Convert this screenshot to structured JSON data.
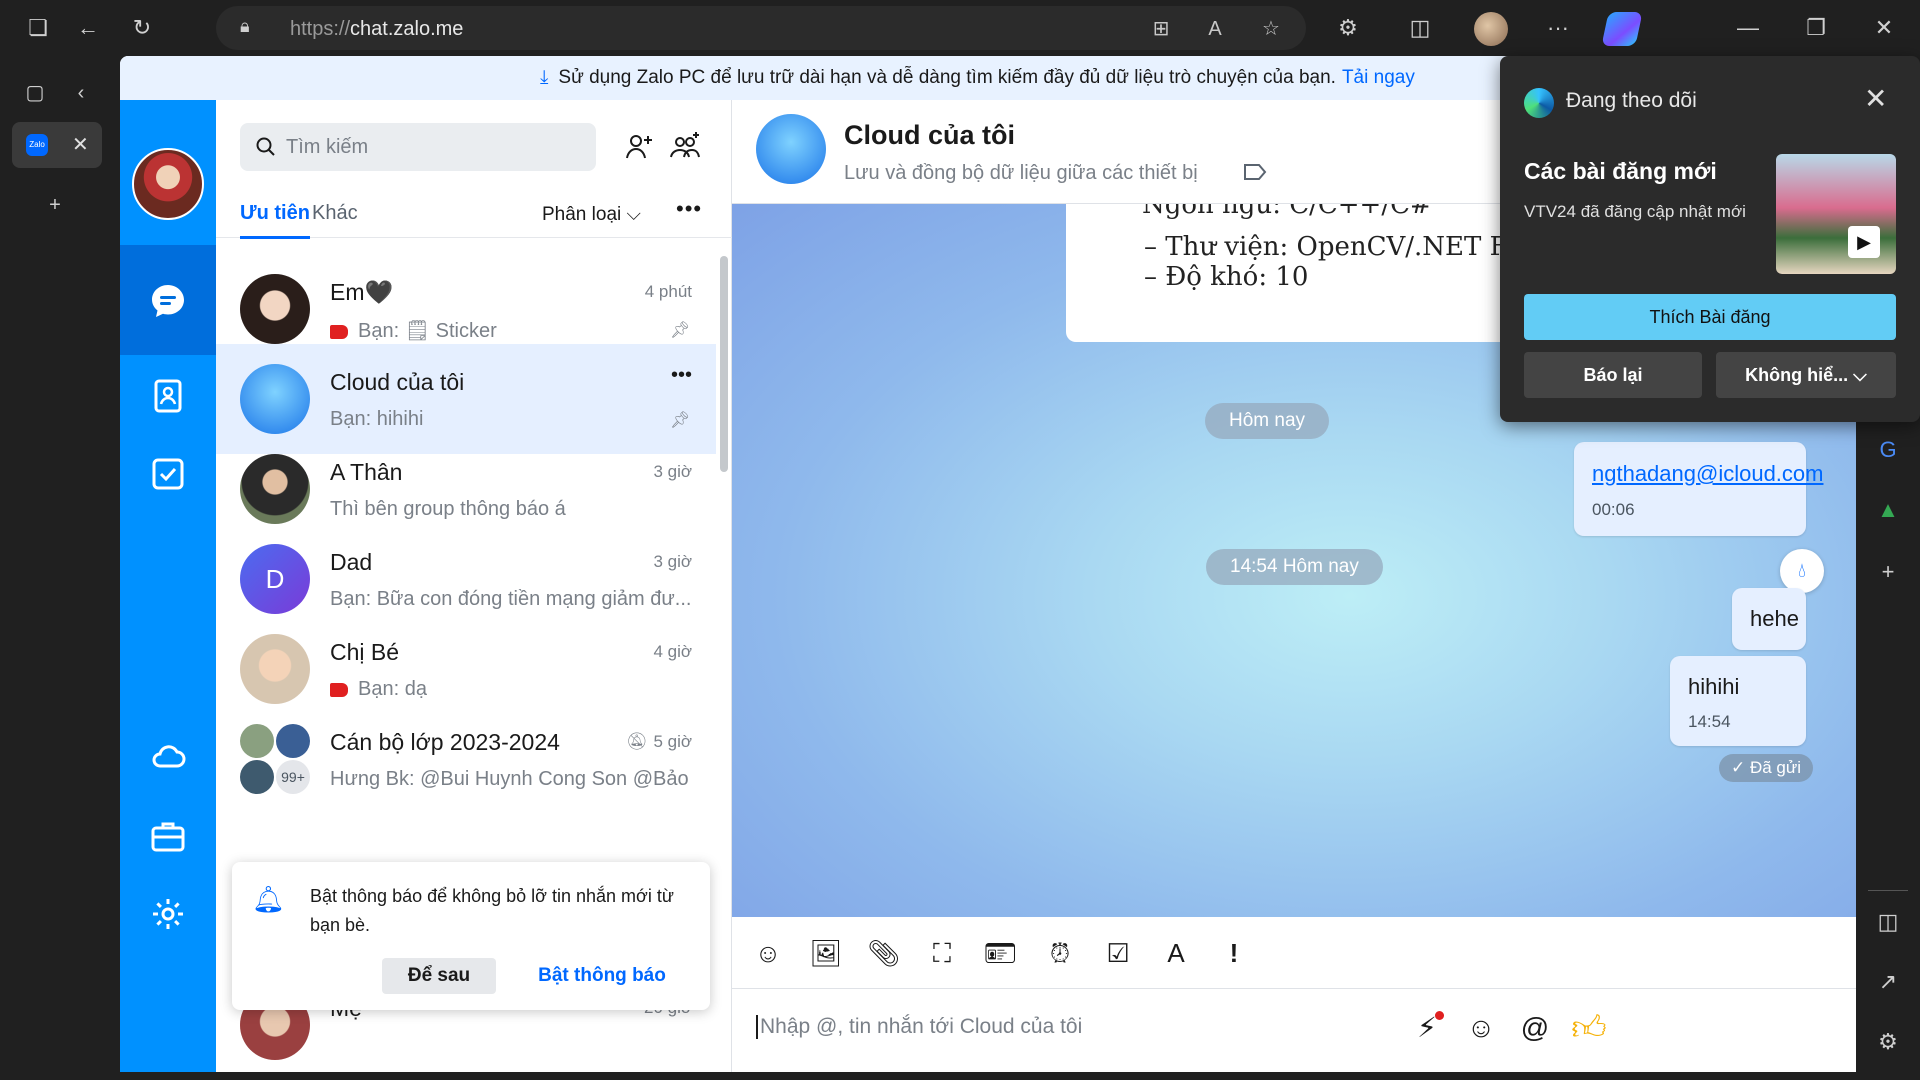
{
  "browser": {
    "url_prefix": "https://",
    "url_host": "chat.zalo.me"
  },
  "banner": {
    "text": "Sử dụng Zalo PC để lưu trữ dài hạn và dễ dàng tìm kiếm đầy đủ dữ liệu trò chuyện của bạn.",
    "link": "Tải ngay"
  },
  "tab": {
    "favicon": "Zalo"
  },
  "search": {
    "placeholder": "Tìm kiếm"
  },
  "list_tabs": {
    "priority": "Ưu tiên",
    "other": "Khác",
    "filter": "Phân loại",
    "more": "•••"
  },
  "conversations": [
    {
      "name": "Em🖤",
      "message": "Bạn: 🗒 Sticker",
      "time": "4 phút",
      "pinned": true,
      "tag": true
    },
    {
      "name": "Cloud của tôi",
      "message": "Bạn: hihihi",
      "time": "•••",
      "pinned": true,
      "selected": true
    },
    {
      "name": "A Thân",
      "message": "Thì bên group thông báo á",
      "time": "3 giờ"
    },
    {
      "name": "Dad",
      "initial": "D",
      "message": "Bạn: Bữa con đóng tiền mạng giảm đư...",
      "time": "3 giờ"
    },
    {
      "name": "Chị Bé",
      "message": "Bạn: dạ",
      "time": "4 giờ",
      "tag": true
    },
    {
      "name": "Cán bộ lớp 2023-2024",
      "message": "Hưng Bk: @Bui Huynh Cong Son @Bảo",
      "time": "5 giờ",
      "badge": "99+"
    },
    {
      "name": "Mẹ",
      "time": "20 giờ"
    }
  ],
  "notify": {
    "text": "Bật thông báo để không bỏ lỡ tin nhắn mới từ bạn bè.",
    "later": "Để sau",
    "enable": "Bật thông báo"
  },
  "chat": {
    "title": "Cloud của tôi",
    "subtitle": "Lưu và đồng bộ dữ liệu giữa các thiết bị",
    "image_lines": [
      "Ngôn ngữ: C/C++/C#",
      "–  Thư viện: OpenCV/.NET Fran",
      "–  Độ khó: 10"
    ],
    "day_pill": "Hôm nay",
    "time_pill": "14:54 Hôm nay",
    "messages": [
      {
        "text": "ngthadang@icloud.com",
        "time": "00:06",
        "link": true
      },
      {
        "text": "hehe"
      },
      {
        "text": "hihihi",
        "time": "14:54"
      }
    ],
    "status": "✓ Đã gửi",
    "composer_placeholder": "Nhập @, tin nhắn tới Cloud của tôi"
  },
  "popup": {
    "header": "Đang theo dõi",
    "title": "Các bài đăng mới",
    "desc": "VTV24 đã đăng cập nhật mới",
    "like": "Thích Bài đăng",
    "report": "Báo lại",
    "not_interested": "Không hiể...  ⌵"
  },
  "colors": {
    "zalo_blue": "#0091ff",
    "accent": "#0068ff",
    "popup_button": "#62ccf5"
  }
}
